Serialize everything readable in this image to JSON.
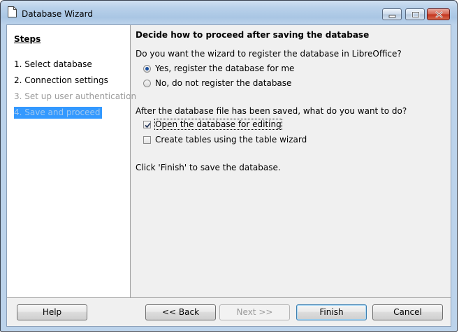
{
  "window": {
    "title": "Database Wizard"
  },
  "steps": {
    "heading": "Steps",
    "items": [
      {
        "label": "1. Select database",
        "state": "done"
      },
      {
        "label": "2. Connection settings",
        "state": "done"
      },
      {
        "label": "3. Set up user authentication",
        "state": "disabled"
      },
      {
        "label": "4. Save and proceed",
        "state": "current"
      }
    ]
  },
  "main": {
    "title": "Decide how to proceed after saving the database",
    "register_question": "Do you want the wizard to register the database in LibreOffice?",
    "register_options": [
      {
        "label": "Yes, register the database for me",
        "selected": true
      },
      {
        "label": "No, do not register the database",
        "selected": false
      }
    ],
    "after_save_question": "After the database file has been saved, what do you want to do?",
    "after_save_options": [
      {
        "label": "Open the database for editing",
        "checked": true
      },
      {
        "label": "Create tables using the table wizard",
        "checked": false
      }
    ],
    "finish_hint": "Click 'Finish' to save the database."
  },
  "buttons": {
    "help": "Help",
    "back": "<< Back",
    "next": "Next >>",
    "finish": "Finish",
    "cancel": "Cancel"
  },
  "colors": {
    "selection": "#3399ff",
    "disabled_text": "#9a9a9a"
  }
}
